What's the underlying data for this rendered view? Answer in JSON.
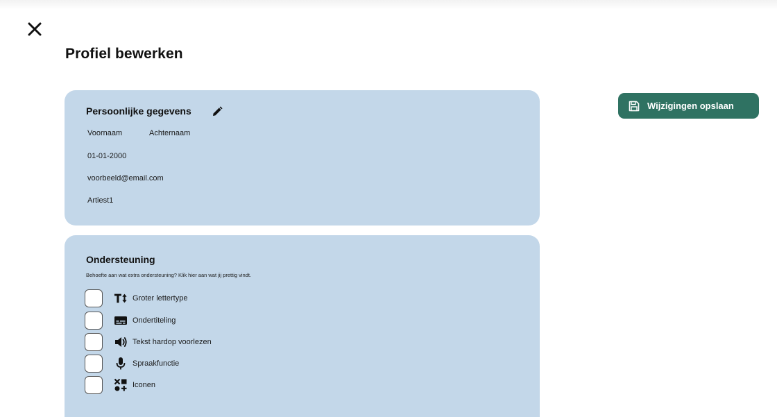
{
  "page": {
    "title": "Profiel bewerken"
  },
  "actions": {
    "save_label": "Wijzigingen opslaan"
  },
  "personal": {
    "heading": "Persoonlijke gegevens",
    "first_name": "Voornaam",
    "last_name": "Achternaam",
    "birthdate": "01-01-2000",
    "email": "voorbeeld@email.com",
    "username": "Artiest1"
  },
  "support": {
    "heading": "Ondersteuning",
    "description": "Behoefte aan wat extra ondersteuning? Klik hier aan wat jij prettig vindt.",
    "options": [
      {
        "label": "Groter lettertype",
        "icon": "text-size-icon",
        "checked": false
      },
      {
        "label": "Ondertiteling",
        "icon": "subtitles-icon",
        "checked": false
      },
      {
        "label": "Tekst hardop voorlezen",
        "icon": "speaker-icon",
        "checked": false
      },
      {
        "label": "Spraakfunctie",
        "icon": "microphone-icon",
        "checked": false
      },
      {
        "label": "Iconen",
        "icon": "icons-icon",
        "checked": false
      }
    ]
  },
  "colors": {
    "card_background": "#c3d7e9",
    "save_button": "#2f7262"
  }
}
